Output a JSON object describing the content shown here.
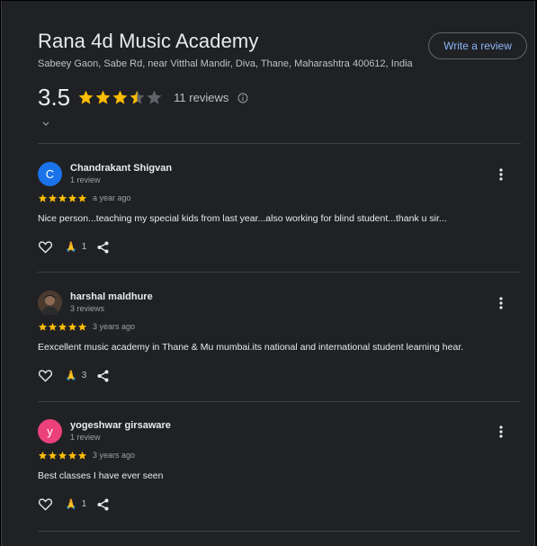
{
  "place": {
    "name": "Rana 4d Music Academy",
    "address": "Sabeey Gaon, Sabe Rd, near Vitthal Mandir, Diva, Thane, Maharashtra 400612, India"
  },
  "write_review_label": "Write a review",
  "rating": {
    "value": "3.5",
    "stars": 3.5,
    "reviews_label": "11 reviews"
  },
  "colors": {
    "star": "#fbbc04",
    "star_empty": "#5f6368",
    "link": "#8ab4f8"
  },
  "reviews": [
    {
      "avatar_letter": "C",
      "avatar_color": "#1a73e8",
      "name": "Chandrakant Shigvan",
      "count": "1 review",
      "stars": 5,
      "date": "a year ago",
      "text": "Nice person...teaching my special kids from last year...also working for blind student...thank u sir...",
      "reaction_emoji": "🙏",
      "reactions": "1"
    },
    {
      "avatar_letter": "",
      "avatar_color": "#5b4638",
      "name": "harshal maldhure",
      "count": "3 reviews",
      "stars": 5,
      "date": "3 years ago",
      "text": "Eexcellent music academy in Thane & Mu mumbai.its national and international student learning hear.",
      "reaction_emoji": "🙏",
      "reactions": "3"
    },
    {
      "avatar_letter": "y",
      "avatar_color": "#ec407a",
      "name": "yogeshwar girsaware",
      "count": "1 review",
      "stars": 5,
      "date": "3 years ago",
      "text": "Best classes I have ever seen",
      "reaction_emoji": "🙏",
      "reactions": "1"
    }
  ]
}
